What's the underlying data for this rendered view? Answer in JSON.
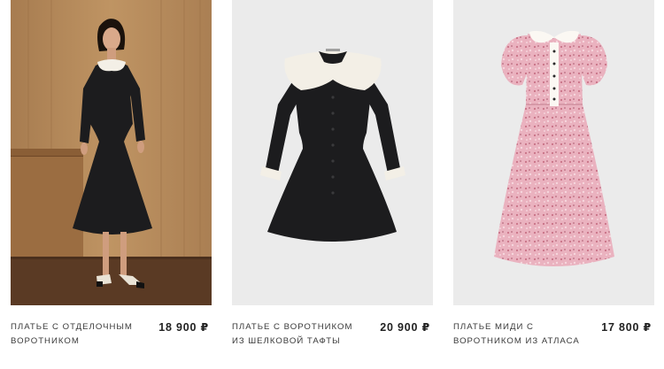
{
  "products": [
    {
      "name": "платье с отделочным воротником",
      "price": "18 900 ₽"
    },
    {
      "name": "платье с воротником из шелковой тафты",
      "price": "20 900 ₽"
    },
    {
      "name": "платье миди с воротником из атласа",
      "price": "17 800 ₽"
    }
  ],
  "colors": {
    "wood_background": "#b08458",
    "studio_background": "#ebebeb",
    "dress_black": "#1c1c1e",
    "collar_white": "#f3efe6",
    "floral_pink": "#eab2bf"
  }
}
